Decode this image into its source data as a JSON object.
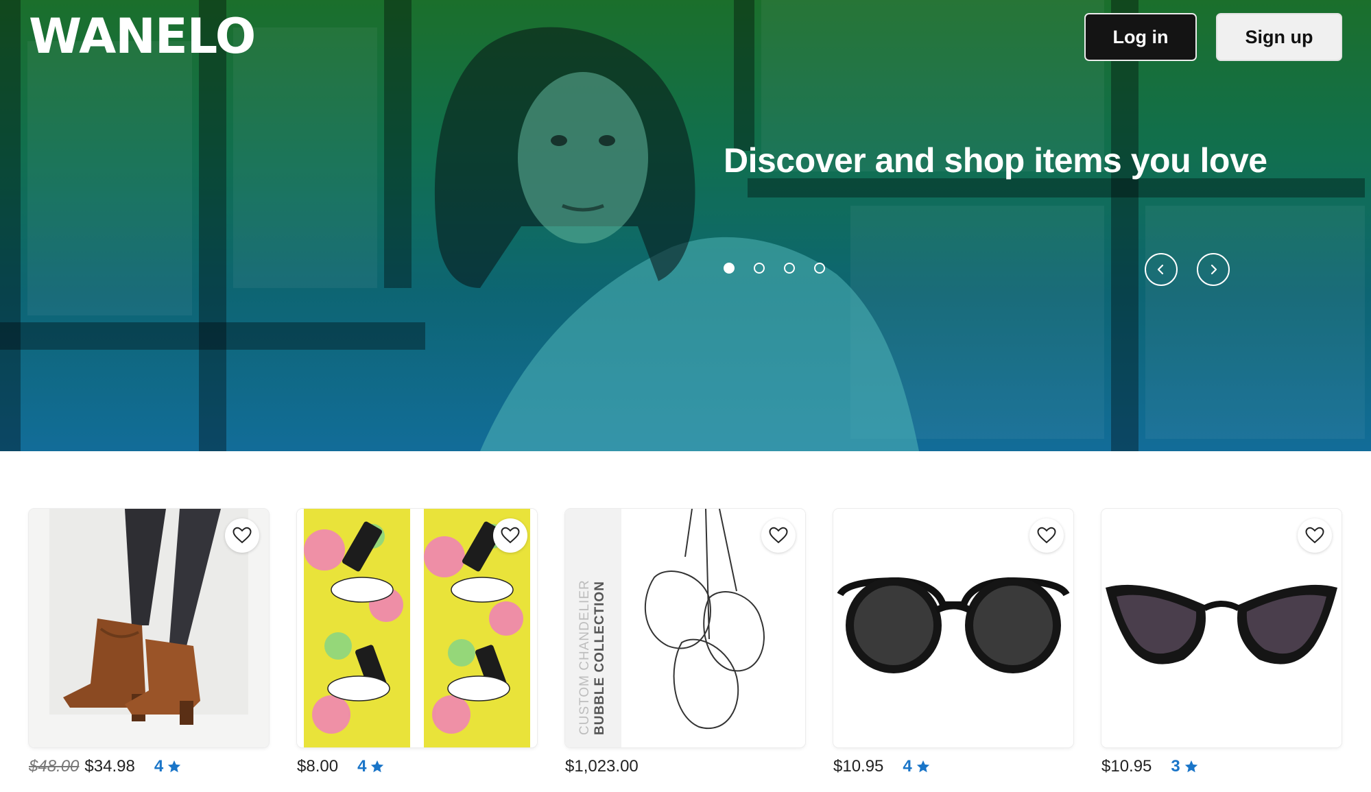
{
  "brand": {
    "logo": "WANELO"
  },
  "header": {
    "login_label": "Log in",
    "signup_label": "Sign up"
  },
  "hero": {
    "tagline": "Discover and shop items you love",
    "slide_count": 4,
    "active_slide": 1
  },
  "colors": {
    "rating_blue": "#1a75c8",
    "hero_top": "#1f7a2c",
    "hero_bottom": "#1577a6"
  },
  "products": [
    {
      "name": "boots",
      "original_price": "$48.00",
      "price": "$34.98",
      "rating": "4"
    },
    {
      "name": "socks",
      "original_price": "",
      "price": "$8.00",
      "rating": "4"
    },
    {
      "name": "chandelier",
      "original_price": "",
      "price": "$1,023.00",
      "rating": "",
      "image_text_1": "CUSTOM CHANDELIER",
      "image_text_2": "BUBBLE COLLECTION"
    },
    {
      "name": "round-sunglasses",
      "original_price": "",
      "price": "$10.95",
      "rating": "4"
    },
    {
      "name": "cat-eye-sunglasses",
      "original_price": "",
      "price": "$10.95",
      "rating": "3"
    }
  ]
}
